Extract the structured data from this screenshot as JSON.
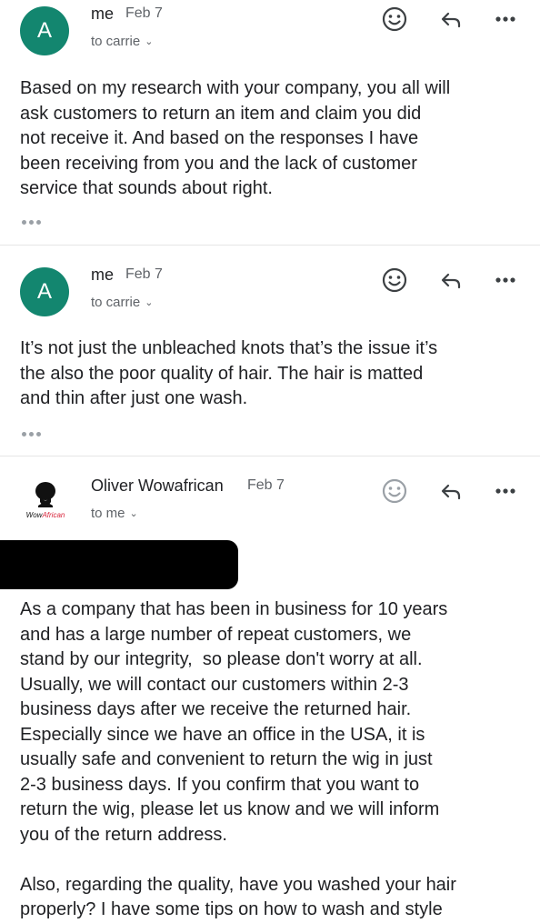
{
  "messages": [
    {
      "avatar_letter": "A",
      "sender": "me",
      "date": "Feb 7",
      "recipient": "to carrie",
      "body": "Based on my research with your company, you all will\nask customers to return an item and claim you did\nnot receive it. And based on the responses I have\nbeen receiving from you and the lack of customer\nservice that sounds about right."
    },
    {
      "avatar_letter": "A",
      "sender": "me",
      "date": "Feb 7",
      "recipient": "to carrie",
      "body": "It’s not just the unbleached knots that’s the issue it’s\nthe also the poor quality of hair. The hair is matted\nand thin after just one wash."
    },
    {
      "logo_text_a": "Wow",
      "logo_text_b": "African",
      "sender": "Oliver Wowafrican",
      "date": "Feb 7",
      "recipient": "to me",
      "body": "As a company that has been in business for 10 years\nand has a large number of repeat customers, we\nstand by our integrity,  so please don't worry at all.\nUsually, we will contact our customers within 2-3\nbusiness days after we receive the returned hair.\nEspecially since we have an office in the USA, it is\nusually safe and convenient to return the wig in just\n2-3 business days. If you confirm that you want to\nreturn the wig, please let us know and we will inform\nyou of the return address.\n\nAlso, regarding the quality, have you washed your hair\nproperly? I have some tips on how to wash and style"
    }
  ],
  "icons": [
    "emoji-icon",
    "reply-icon",
    "more-icon"
  ],
  "colors": {
    "avatar": "#13866f",
    "logo_accent": "#d8243a"
  }
}
